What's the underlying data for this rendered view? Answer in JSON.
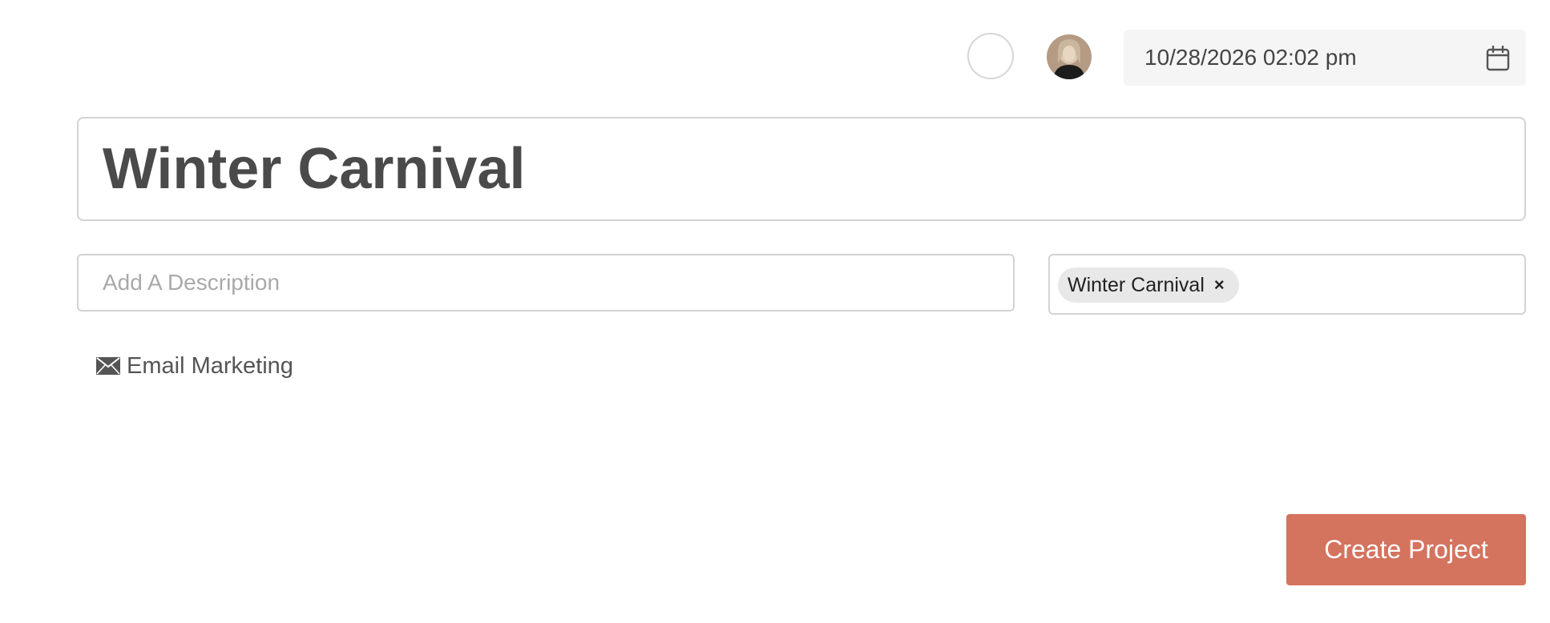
{
  "header": {
    "status_indicator": "empty-circle",
    "assignee_avatar": "user-avatar",
    "due_date": "10/28/2026 02:02 pm",
    "due_date_icon": "calendar-icon"
  },
  "project": {
    "title": "Winter Carnival",
    "description_value": "",
    "description_placeholder": "Add A Description",
    "tags": [
      {
        "label": "Winter Carnival",
        "remove_symbol": "×"
      }
    ]
  },
  "channel": {
    "icon": "envelope-icon",
    "label": "Email Marketing"
  },
  "actions": {
    "create_label": "Create Project"
  },
  "colors": {
    "primary_button": "#d4735e",
    "date_field_bg": "#f5f5f5",
    "border": "#d3d3d3",
    "tag_bg": "#e8e8e8"
  }
}
